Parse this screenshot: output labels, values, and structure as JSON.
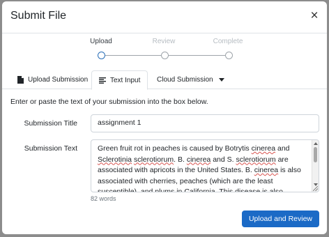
{
  "modal": {
    "title": "Submit File",
    "close_label": "×"
  },
  "stepper": {
    "steps": [
      {
        "label": "Upload",
        "active": true
      },
      {
        "label": "Review",
        "active": false
      },
      {
        "label": "Complete",
        "active": false
      }
    ]
  },
  "tabs": [
    {
      "label": "Upload Submission",
      "icon": "file-icon",
      "active": false
    },
    {
      "label": "Text Input",
      "icon": "align-left-icon",
      "active": true
    },
    {
      "label": "Cloud Submission",
      "icon": "caret-down-icon",
      "active": false
    }
  ],
  "form": {
    "instructions": "Enter or paste the text of your submission into the box below.",
    "title_label": "Submission Title",
    "title_value": "assignment 1",
    "text_label": "Submission Text",
    "text_segments": [
      {
        "t": "Green fruit rot in peaches is caused by Botrytis ",
        "spell": false
      },
      {
        "t": "cinerea",
        "spell": true
      },
      {
        "t": " and ",
        "spell": false
      },
      {
        "t": "Sclerotinia",
        "spell": true
      },
      {
        "t": " ",
        "spell": false
      },
      {
        "t": "sclerotiorum",
        "spell": true
      },
      {
        "t": ".  B. ",
        "spell": false
      },
      {
        "t": "cinerea",
        "spell": true
      },
      {
        "t": "  and S. ",
        "spell": false
      },
      {
        "t": "sclerotiorum",
        "spell": true
      },
      {
        "t": " are associated with apricots in the United States.  B. ",
        "spell": false
      },
      {
        "t": "cinerea",
        "spell": true
      },
      {
        "t": " is also associated with cherries, peaches (which are the least susceptible), and plums in California.  This disease is also",
        "spell": false
      }
    ],
    "word_count": "82 words"
  },
  "footer": {
    "submit_label": "Upload and Review"
  },
  "colors": {
    "primary": "#1b6ac6",
    "active_step": "#2a6fb8",
    "backdrop": "#8c8c8c"
  }
}
